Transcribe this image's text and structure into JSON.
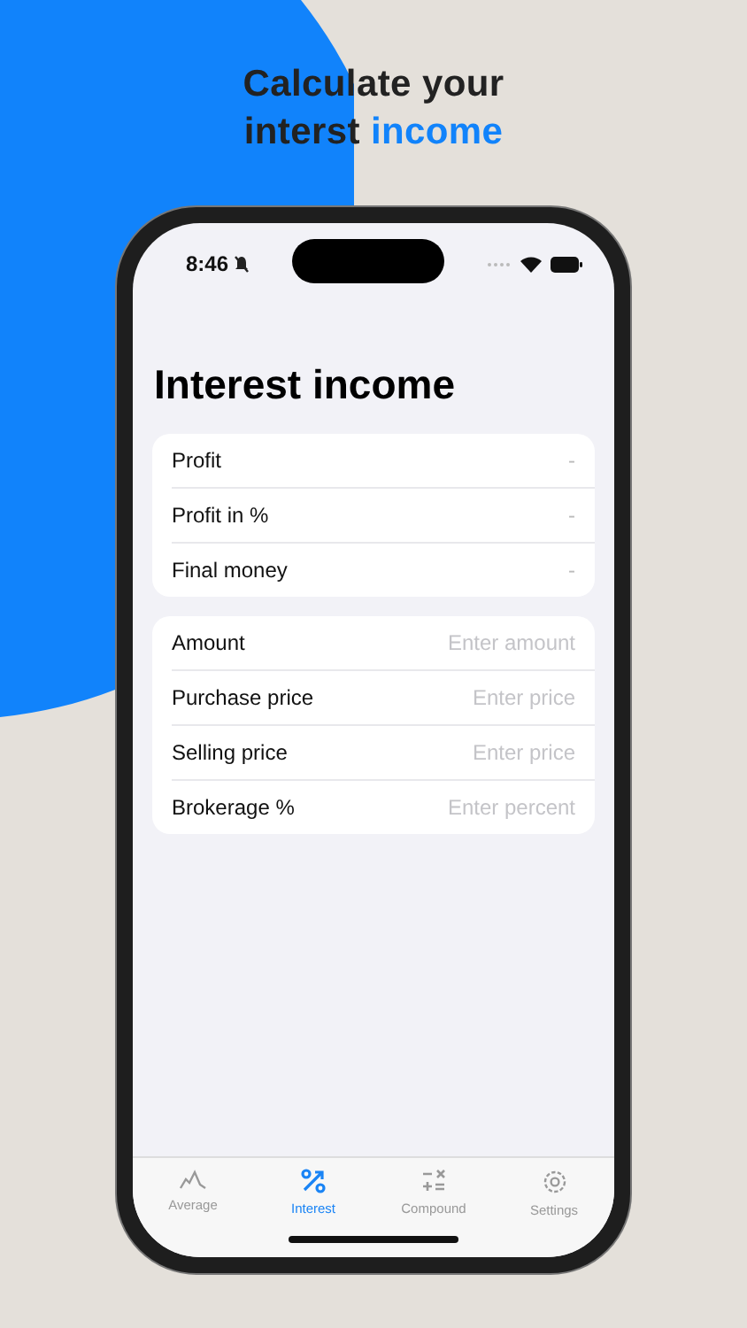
{
  "headline": {
    "line1": "Calculate your",
    "line2": "interst",
    "highlight": "income"
  },
  "status_bar": {
    "time": "8:46"
  },
  "title": "Interest income",
  "results": [
    {
      "label": "Profit",
      "value": "-"
    },
    {
      "label": "Profit in %",
      "value": "-"
    },
    {
      "label": "Final money",
      "value": "-"
    }
  ],
  "inputs": [
    {
      "label": "Amount",
      "placeholder": "Enter amount"
    },
    {
      "label": "Purchase price",
      "placeholder": "Enter price"
    },
    {
      "label": "Selling price",
      "placeholder": "Enter price"
    },
    {
      "label": "Brokerage %",
      "placeholder": "Enter percent"
    }
  ],
  "tabs": [
    {
      "label": "Average",
      "selected": false
    },
    {
      "label": "Interest",
      "selected": true
    },
    {
      "label": "Compound",
      "selected": false
    },
    {
      "label": "Settings",
      "selected": false
    }
  ]
}
